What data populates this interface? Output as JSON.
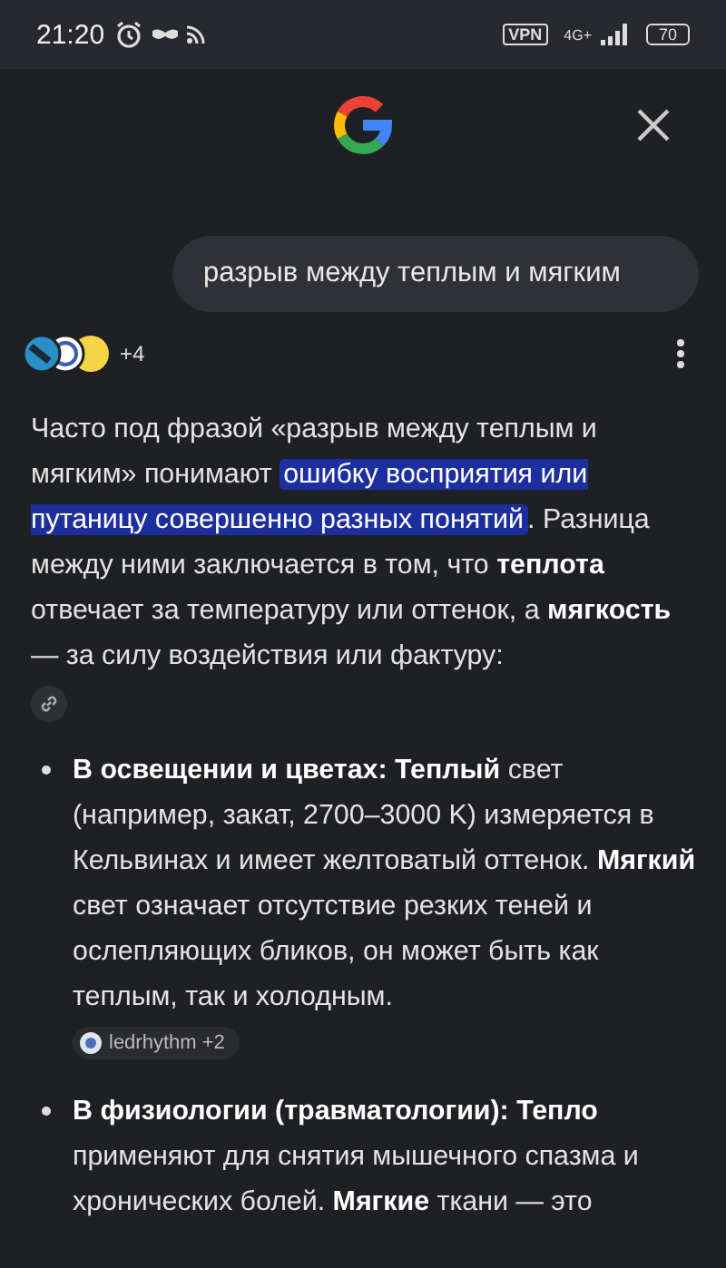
{
  "status_bar": {
    "time": "21:20",
    "network": "4G+",
    "battery": "70",
    "vpn": "VPN"
  },
  "query": "разрыв между теплым и мягким",
  "sources": {
    "more": "+4"
  },
  "intro": {
    "before": "Часто под фразой «разрыв между теплым и мягким» понимают ",
    "highlight": "ошибку восприятия или путаницу совершенно разных понятий",
    "after": ". Разница между ними заключается в том, что **теплота** отвечает за температуру или оттенок, а **мягкость** — за силу воздействия или фактуру:"
  },
  "bullets": [
    {
      "text": "**В освещении и цветах: Теплый** свет (например, закат, 2700–3000 K) измеряется в Кельвинах и имеет желтоватый оттенок. **Мягкий** свет означает отсутствие резких теней и ослепляющих бликов, он может быть как теплым, так и холодным.",
      "source": "ledrhythm +2"
    },
    {
      "text": "**В физиологии (травматологии): Тепло** применяют для снятия мышечного спазма и хронических болей. **Мягкие** ткани — это"
    }
  ]
}
